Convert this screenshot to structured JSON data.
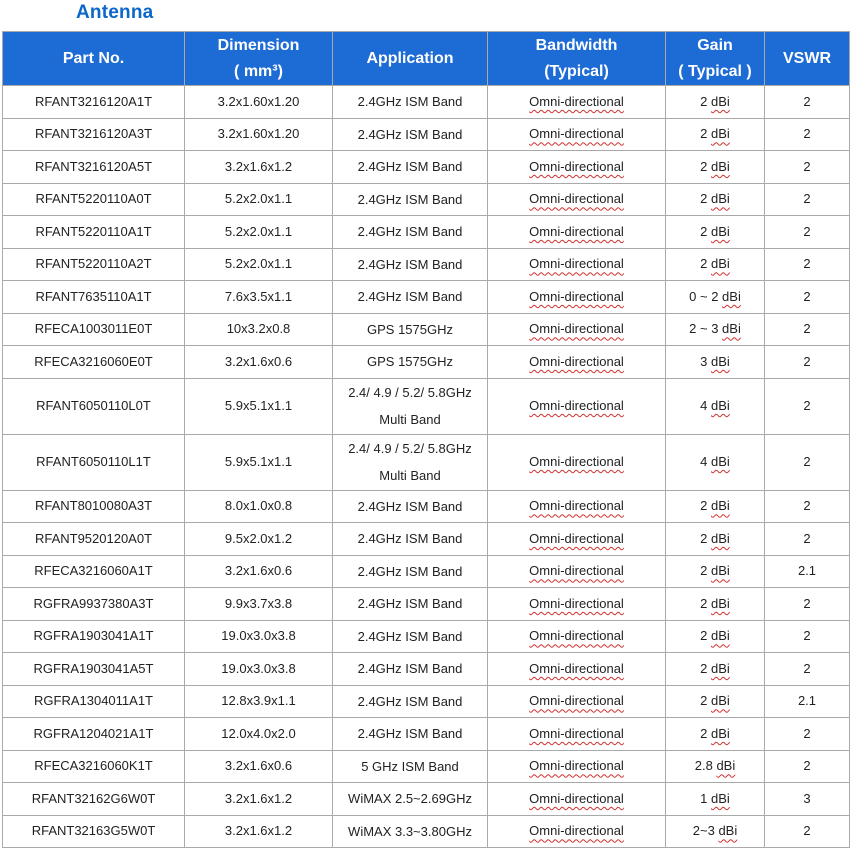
{
  "title": "Antenna",
  "headers": {
    "part_no": "Part No.",
    "dimension_line1": "Dimension",
    "dimension_line2": "( mm³)",
    "application": "Application",
    "bandwidth_line1": "Bandwidth",
    "bandwidth_line2": "(Typical)",
    "gain_line1": "Gain",
    "gain_line2": "( Typical )",
    "vswr": "VSWR"
  },
  "rows": [
    {
      "part": "RFANT3216120A1T",
      "dim": "3.2x1.60x1.20",
      "app1": "2.4GHz ISM Band",
      "app2": "",
      "band": "Omni-directional",
      "gain_pre": "2 ",
      "gain_unit": "dBi",
      "vswr": "2"
    },
    {
      "part": "RFANT3216120A3T",
      "dim": "3.2x1.60x1.20",
      "app1": "2.4GHz ISM Band",
      "app2": "",
      "band": "Omni-directional",
      "gain_pre": "2 ",
      "gain_unit": "dBi",
      "vswr": "2"
    },
    {
      "part": "RFANT3216120A5T",
      "dim": "3.2x1.6x1.2",
      "app1": "2.4GHz ISM Band",
      "app2": "",
      "band": "Omni-directional",
      "gain_pre": "2 ",
      "gain_unit": "dBi",
      "vswr": "2"
    },
    {
      "part": "RFANT5220110A0T",
      "dim": "5.2x2.0x1.1",
      "app1": "2.4GHz ISM Band",
      "app2": "",
      "band": "Omni-directional",
      "gain_pre": "2 ",
      "gain_unit": "dBi",
      "vswr": "2"
    },
    {
      "part": "RFANT5220110A1T",
      "dim": "5.2x2.0x1.1",
      "app1": "2.4GHz ISM Band",
      "app2": "",
      "band": "Omni-directional",
      "gain_pre": "2 ",
      "gain_unit": "dBi",
      "vswr": "2"
    },
    {
      "part": "RFANT5220110A2T",
      "dim": "5.2x2.0x1.1",
      "app1": "2.4GHz ISM Band",
      "app2": "",
      "band": "Omni-directional",
      "gain_pre": "2 ",
      "gain_unit": "dBi",
      "vswr": "2"
    },
    {
      "part": "RFANT7635110A1T",
      "dim": "7.6x3.5x1.1",
      "app1": "2.4GHz ISM Band",
      "app2": "",
      "band": "Omni-directional",
      "gain_pre": "0 ~ 2 ",
      "gain_unit": "dBi",
      "vswr": "2"
    },
    {
      "part": "RFECA1003011E0T",
      "dim": "10x3.2x0.8",
      "app1": "GPS 1575GHz",
      "app2": "",
      "band": "Omni-directional",
      "gain_pre": "2 ~ 3 ",
      "gain_unit": "dBi",
      "vswr": "2"
    },
    {
      "part": "RFECA3216060E0T",
      "dim": "3.2x1.6x0.6",
      "app1": "GPS 1575GHz",
      "app2": "",
      "band": "Omni-directional",
      "gain_pre": "3 ",
      "gain_unit": "dBi",
      "vswr": "2"
    },
    {
      "part": "RFANT6050110L0T",
      "dim": "5.9x5.1x1.1",
      "app1": "2.4/ 4.9 / 5.2/ 5.8GHz",
      "app2": "Multi Band",
      "band": "Omni-directional",
      "gain_pre": "4 ",
      "gain_unit": "dBi",
      "vswr": "2"
    },
    {
      "part": "RFANT6050110L1T",
      "dim": "5.9x5.1x1.1",
      "app1": "2.4/ 4.9 / 5.2/ 5.8GHz",
      "app2": "Multi Band",
      "band": "Omni-directional",
      "gain_pre": "4 ",
      "gain_unit": "dBi",
      "vswr": "2"
    },
    {
      "part": "RFANT8010080A3T",
      "dim": "8.0x1.0x0.8",
      "app1": "2.4GHz ISM Band",
      "app2": "",
      "band": "Omni-directional",
      "gain_pre": "2 ",
      "gain_unit": "dBi",
      "vswr": "2"
    },
    {
      "part": "RFANT9520120A0T",
      "dim": "9.5x2.0x1.2",
      "app1": "2.4GHz ISM Band",
      "app2": "",
      "band": "Omni-directional",
      "gain_pre": "2 ",
      "gain_unit": "dBi",
      "vswr": "2"
    },
    {
      "part": "RFECA3216060A1T",
      "dim": "3.2x1.6x0.6",
      "app1": "2.4GHz ISM Band",
      "app2": "",
      "band": "Omni-directional",
      "gain_pre": "2 ",
      "gain_unit": "dBi",
      "vswr": "2.1"
    },
    {
      "part": "RGFRA9937380A3T",
      "dim": "9.9x3.7x3.8",
      "app1": "2.4GHz ISM Band",
      "app2": "",
      "band": "Omni-directional",
      "gain_pre": "2 ",
      "gain_unit": "dBi",
      "vswr": "2"
    },
    {
      "part": "RGFRA1903041A1T",
      "dim": "19.0x3.0x3.8",
      "app1": "2.4GHz ISM Band",
      "app2": "",
      "band": "Omni-directional",
      "gain_pre": "2 ",
      "gain_unit": "dBi",
      "vswr": "2"
    },
    {
      "part": "RGFRA1903041A5T",
      "dim": "19.0x3.0x3.8",
      "app1": "2.4GHz ISM Band",
      "app2": "",
      "band": "Omni-directional",
      "gain_pre": "2 ",
      "gain_unit": "dBi",
      "vswr": "2"
    },
    {
      "part": "RGFRA1304011A1T",
      "dim": "12.8x3.9x1.1",
      "app1": "2.4GHz ISM Band",
      "app2": "",
      "band": "Omni-directional",
      "gain_pre": "2 ",
      "gain_unit": "dBi",
      "vswr": "2.1"
    },
    {
      "part": "RGFRA1204021A1T",
      "dim": "12.0x4.0x2.0",
      "app1": "2.4GHz ISM Band",
      "app2": "",
      "band": "Omni-directional",
      "gain_pre": "2 ",
      "gain_unit": "dBi",
      "vswr": "2"
    },
    {
      "part": "RFECA3216060K1T",
      "dim": "3.2x1.6x0.6",
      "app1": "5 GHz ISM Band",
      "app2": "",
      "band": "Omni-directional",
      "gain_pre": "2.8 ",
      "gain_unit": "dBi",
      "vswr": "2"
    },
    {
      "part": "RFANT32162G6W0T",
      "dim": "3.2x1.6x1.2",
      "app1": "WiMAX 2.5~2.69GHz",
      "app2": "",
      "band": "Omni-directional",
      "gain_pre": "1 ",
      "gain_unit": "dBi",
      "vswr": "3"
    },
    {
      "part": "RFANT32163G5W0T",
      "dim": "3.2x1.6x1.2",
      "app1": "WiMAX 3.3~3.80GHz",
      "app2": "",
      "band": "Omni-directional",
      "gain_pre": "2~3 ",
      "gain_unit": "dBi",
      "vswr": "2"
    }
  ],
  "colors": {
    "header_bg": "#1d6bd5",
    "title": "#0b68c8",
    "spellcheck_underline": "#d03030"
  }
}
